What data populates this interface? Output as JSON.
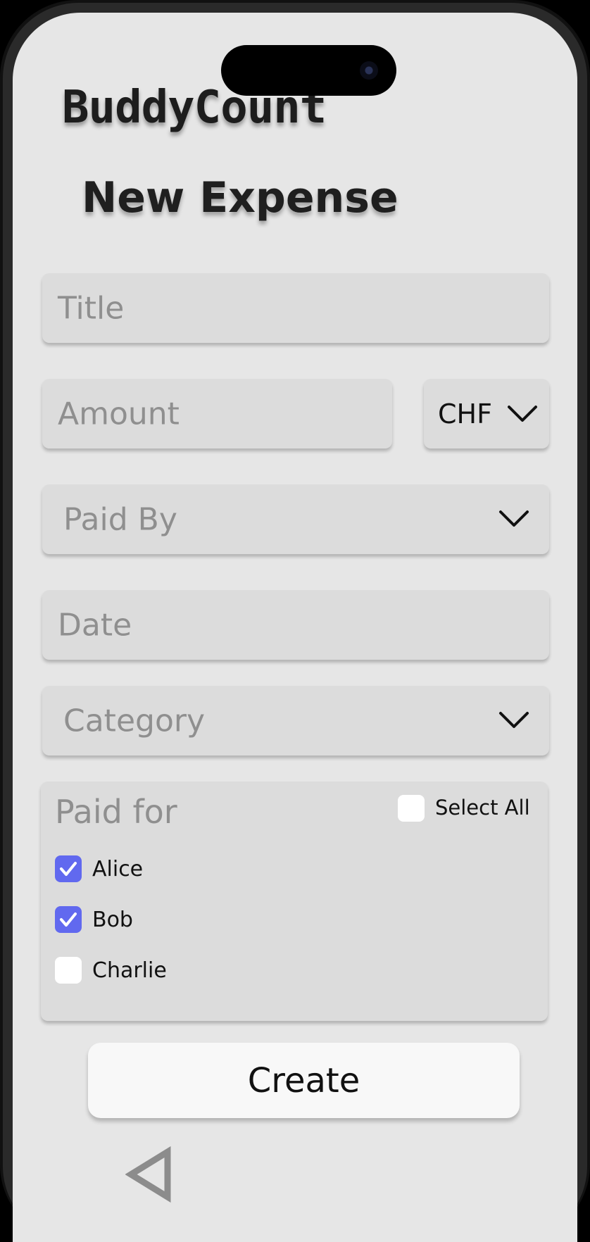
{
  "app": {
    "name": "BuddyCount"
  },
  "page": {
    "title": "New Expense"
  },
  "form": {
    "title_placeholder": "Title",
    "amount_placeholder": "Amount",
    "currency": "CHF",
    "paid_by_placeholder": "Paid By",
    "date_placeholder": "Date",
    "category_placeholder": "Category"
  },
  "paid_for": {
    "label": "Paid for",
    "select_all_label": "Select All",
    "select_all_checked": false,
    "members": [
      {
        "name": "Alice",
        "checked": true
      },
      {
        "name": "Bob",
        "checked": true
      },
      {
        "name": "Charlie",
        "checked": false
      }
    ]
  },
  "actions": {
    "create_label": "Create"
  },
  "nav": {
    "back_icon": "back-triangle-icon"
  },
  "colors": {
    "accent": "#6169ef",
    "screen_bg": "#e6e6e6",
    "field_bg": "#dcdcdc"
  }
}
